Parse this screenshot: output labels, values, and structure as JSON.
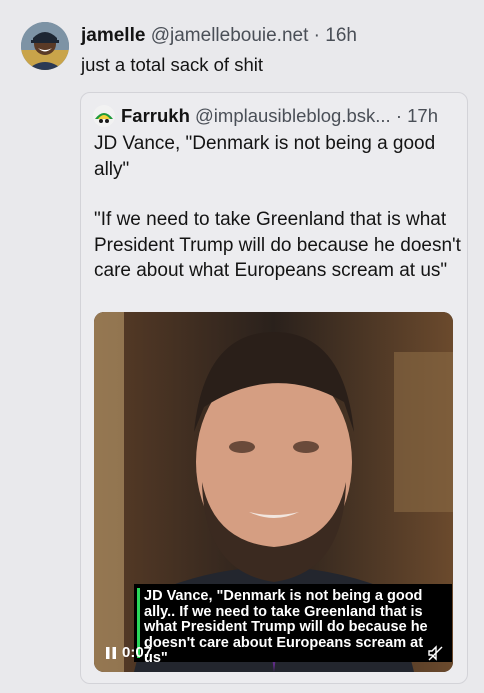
{
  "post": {
    "author_name": "jamelle",
    "author_handle": "@jamellebouie.net",
    "separator": "·",
    "time": "16h",
    "text": "just a total sack of shit"
  },
  "quote": {
    "author_name": "Farrukh",
    "author_handle": "@implausibleblog.bsk...",
    "separator": "·",
    "time": "17h",
    "paragraphs": [
      "JD Vance, \"Denmark is not being a good ally\"",
      "\"If we need to take Greenland that is what President Trump will do because he doesn't care about what Europeans scream at us\""
    ],
    "video": {
      "caption_lines": [
        "JD Vance, \"Denmark is not being a good",
        "ally.. If we need to take Greenland that is",
        "what President Trump will do because he",
        "doesn't care about Europeans scream at us\""
      ],
      "elapsed": "0:07",
      "state": "playing",
      "muted": true
    }
  },
  "colors": {
    "background": "#e9e9ec",
    "text": "#141414",
    "secondary_text": "#4a4f57",
    "caption_accent": "#2bd65a"
  }
}
